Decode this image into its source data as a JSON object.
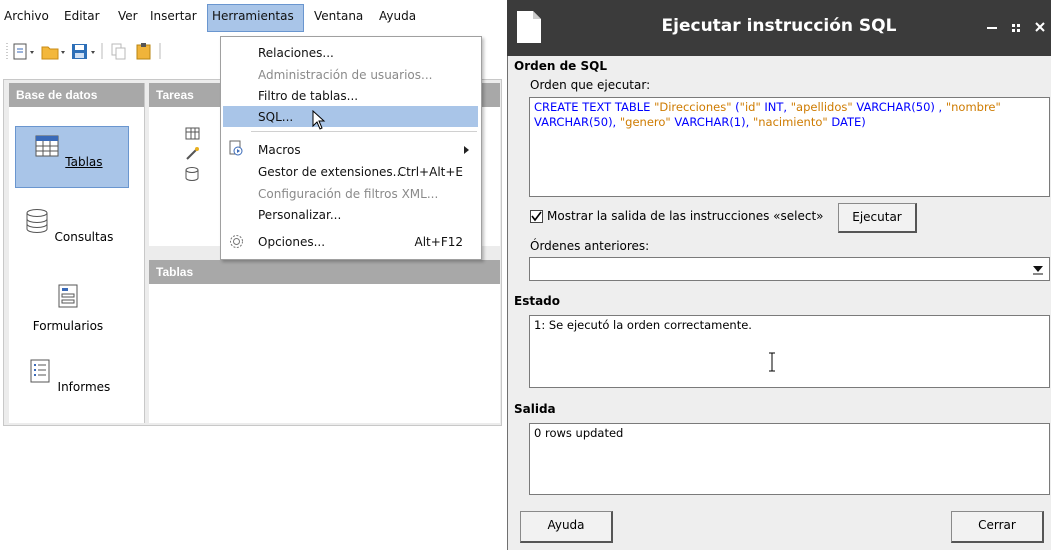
{
  "app": {
    "menubar": [
      {
        "label": "Archivo"
      },
      {
        "label": "Editar"
      },
      {
        "label": "Ver"
      },
      {
        "label": "Insertar"
      },
      {
        "label": "Herramientas"
      },
      {
        "label": "Ventana"
      },
      {
        "label": "Ayuda"
      }
    ],
    "left_header": "Base de datos",
    "tasks_header": "Tareas",
    "tables_header": "Tablas",
    "db_items": [
      {
        "label": "Tablas"
      },
      {
        "label": "Consultas"
      },
      {
        "label": "Formularios"
      },
      {
        "label": "Informes"
      }
    ]
  },
  "menu": {
    "items": [
      {
        "label": "Relaciones..."
      },
      {
        "label": "Administración de usuarios..."
      },
      {
        "label": "Filtro de tablas..."
      },
      {
        "label": "SQL..."
      },
      {
        "label": "Macros"
      },
      {
        "label": "Gestor de extensiones...",
        "shortcut": "Ctrl+Alt+E"
      },
      {
        "label": "Configuración de filtros XML..."
      },
      {
        "label": "Personalizar..."
      },
      {
        "label": "Opciones...",
        "shortcut": "Alt+F12"
      }
    ]
  },
  "dialog": {
    "title": "Ejecutar instrucción SQL",
    "section_sql": "Orden de SQL",
    "command_label": "Orden que ejecutar:",
    "sql": {
      "p1": "CREATE TEXT TABLE",
      "p2": "\"Direcciones\"",
      "p3": "(",
      "p4": "\"id\"",
      "p5": "INT,",
      "p6": "\"apellidos\"",
      "p7": "VARCHAR(50) ,",
      "p8": "\"nombre\"",
      "p9": "VARCHAR(50),",
      "p10": "\"genero\"",
      "p11": "VARCHAR(1),",
      "p12": "\"nacimiento\"",
      "p13": "DATE)"
    },
    "show_output_label": "Mostrar la salida de las instrucciones «select»",
    "show_output_checked": true,
    "execute_button": "Ejecutar",
    "previous_label": "Órdenes anteriores:",
    "previous_value": "",
    "section_status": "Estado",
    "status_text": "1: Se ejecutó la orden correctamente.",
    "section_output": "Salida",
    "output_text": "0 rows updated",
    "help_button": "Ayuda",
    "close_button": "Cerrar"
  }
}
